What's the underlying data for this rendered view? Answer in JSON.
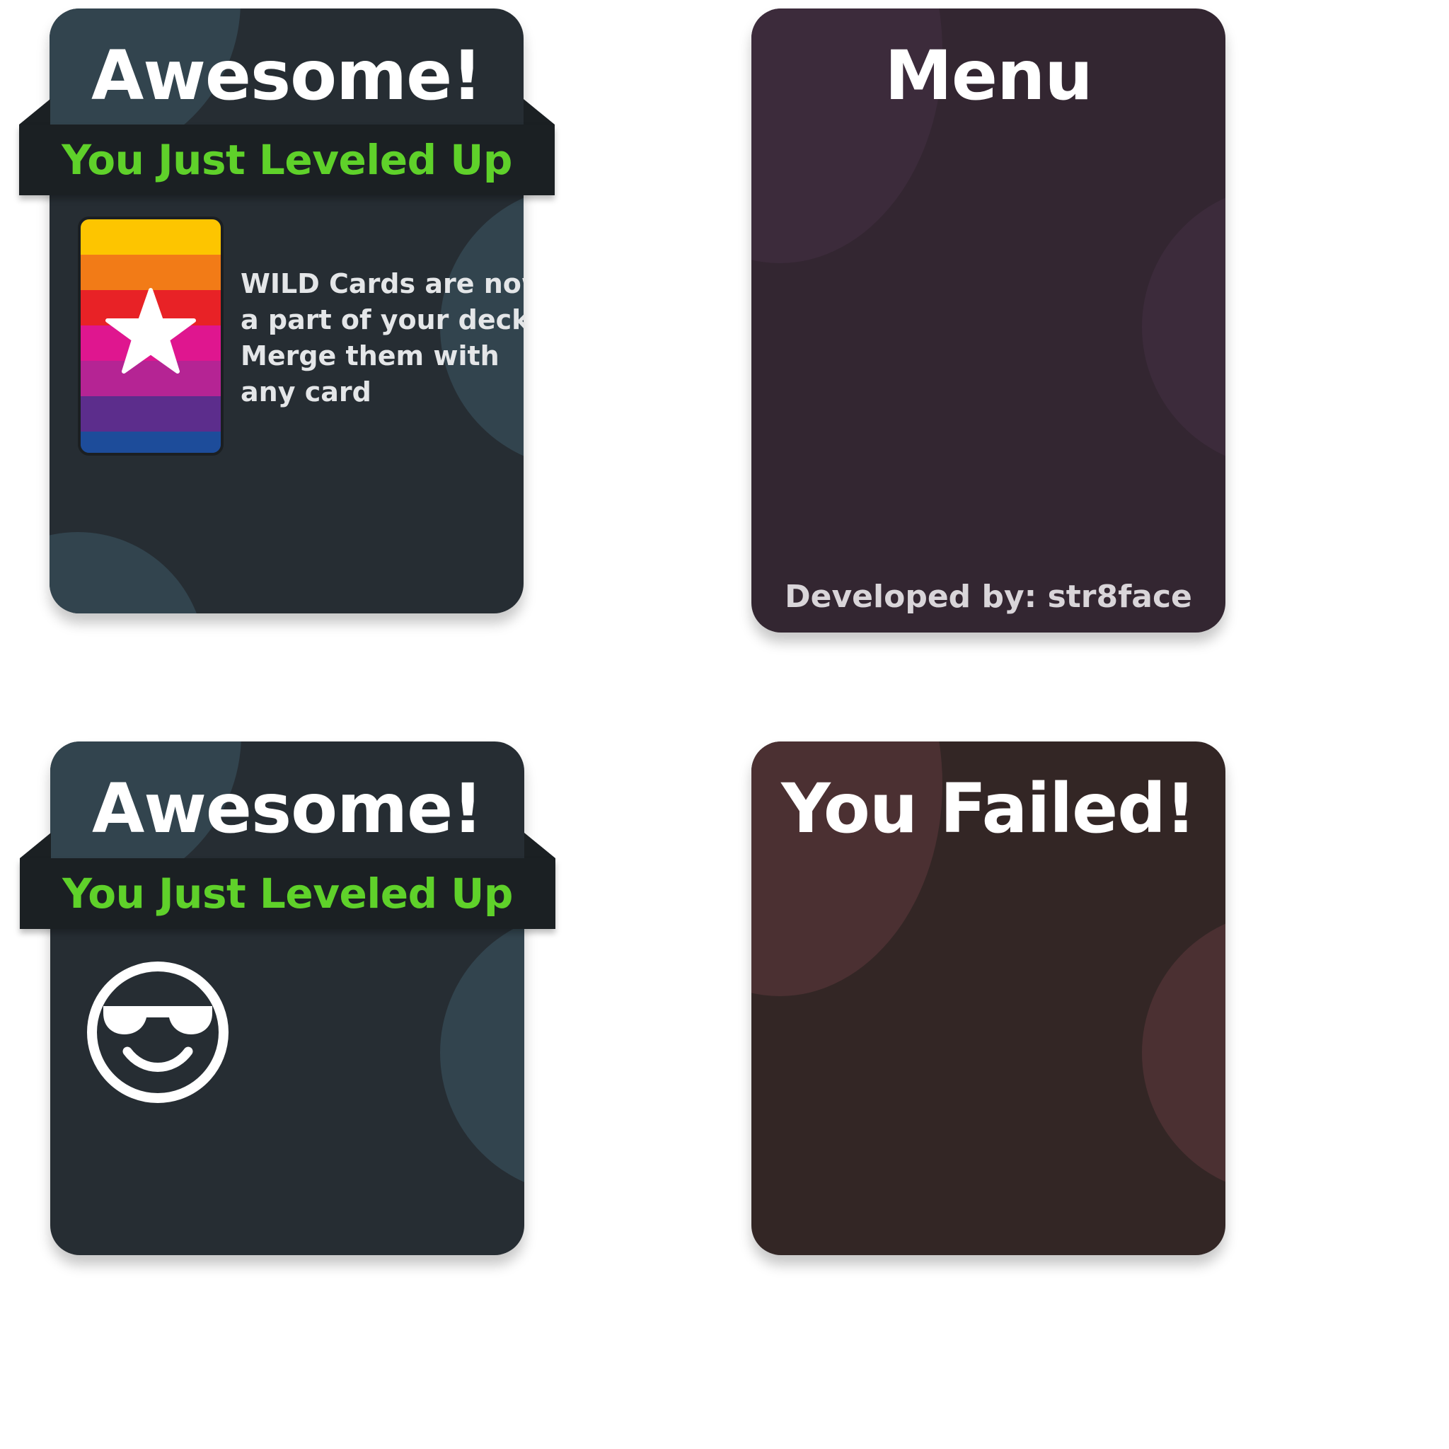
{
  "level_up_wild": {
    "title": "Awesome!",
    "ribbon": "You Just Leveled Up",
    "card_icon": "star-icon",
    "card_stripes": [
      "#fdc500",
      "#f27b17",
      "#e82226",
      "#df168f",
      "#b52494",
      "#5c2d8c",
      "#1d4c9a"
    ],
    "message_lines": [
      "WILD Cards are now",
      "a part of your deck!",
      "Merge them with",
      "any card"
    ]
  },
  "menu": {
    "title": "Menu",
    "credits": "Developed by: str8face"
  },
  "level_up_cool": {
    "title": "Awesome!",
    "ribbon": "You Just Leveled Up",
    "icon": "sunglasses-smiley-icon"
  },
  "failed": {
    "title": "You Failed!"
  },
  "colors": {
    "panel_dark": "#262d33",
    "panel_circle": "#32444e",
    "ribbon": "#1b2023",
    "ribbon_text": "#5fd12a",
    "menu_panel": "#332631",
    "menu_circle": "#3c2b3b",
    "failed_panel": "#332625",
    "failed_circle": "#4b3032"
  }
}
